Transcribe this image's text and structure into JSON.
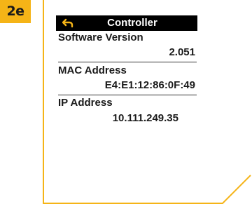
{
  "step_label": "2e",
  "header": {
    "title": "Controller",
    "back_icon": "back-arrow-icon"
  },
  "fields": [
    {
      "label": "Software Version",
      "value": "2.051"
    },
    {
      "label": "MAC Address",
      "value": "E4:E1:12:86:0F:49"
    },
    {
      "label": "IP Address",
      "value": "10.111.249.35"
    }
  ],
  "colors": {
    "badge": "#f5b417",
    "frame_line": "#f5b417",
    "header_bg": "#000000",
    "back_arrow": "#f5b417"
  }
}
